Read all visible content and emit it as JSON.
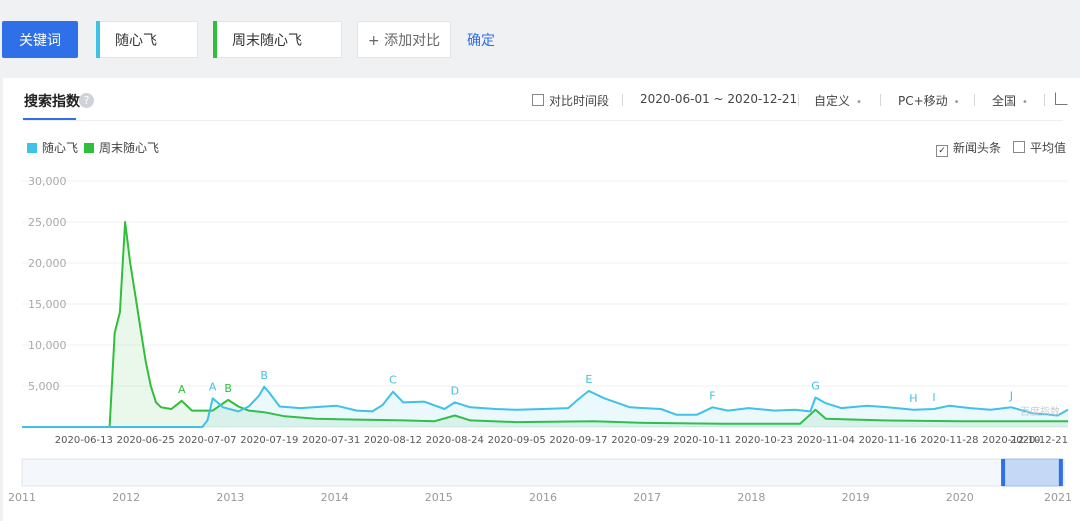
{
  "keywords": {
    "label": "关键词",
    "items": [
      {
        "name": "随心飞",
        "color": "#3fc1e8"
      },
      {
        "name": "周末随心飞",
        "color": "#2fbf3a"
      }
    ],
    "add_label": "+ 添加对比",
    "confirm_label": "确定"
  },
  "panel": {
    "title": "搜索指数",
    "help": "?",
    "compare_period": "对比时间段",
    "date_range": "2020-06-01 ~ 2020-12-21",
    "custom": "自定义",
    "device": "PC+移动",
    "region": "全国",
    "news_label": "新闻头条",
    "avg_label": "平均值",
    "watermark": "百度指数"
  },
  "chart_data": {
    "type": "line",
    "yticks": [
      "30,000",
      "25,000",
      "20,000",
      "15,000",
      "10,000",
      "5,000"
    ],
    "ylim": [
      0,
      30000
    ],
    "xticks": [
      "2020-06-13",
      "2020-06-25",
      "2020-07-07",
      "2020-07-19",
      "2020-07-31",
      "2020-08-12",
      "2020-08-24",
      "2020-09-05",
      "2020-09-17",
      "2020-09-29",
      "2020-10-11",
      "2020-10-23",
      "2020-11-04",
      "2020-11-16",
      "2020-11-28",
      "2020-12-10",
      "2020-12-21"
    ],
    "x_start": "2020-06-01",
    "x_end": "2020-12-21",
    "series": [
      {
        "name": "随心飞",
        "color": "#3fc1e8",
        "points": [
          [
            "2020-06-01",
            0
          ],
          [
            "2020-07-06",
            0
          ],
          [
            "2020-07-07",
            800
          ],
          [
            "2020-07-08",
            3500
          ],
          [
            "2020-07-10",
            2400
          ],
          [
            "2020-07-13",
            1900
          ],
          [
            "2020-07-15",
            2500
          ],
          [
            "2020-07-17",
            3800
          ],
          [
            "2020-07-18",
            4900
          ],
          [
            "2020-07-19",
            4200
          ],
          [
            "2020-07-21",
            2500
          ],
          [
            "2020-07-25",
            2300
          ],
          [
            "2020-08-01",
            2600
          ],
          [
            "2020-08-05",
            2000
          ],
          [
            "2020-08-08",
            1900
          ],
          [
            "2020-08-10",
            2700
          ],
          [
            "2020-08-12",
            4300
          ],
          [
            "2020-08-14",
            3000
          ],
          [
            "2020-08-18",
            3100
          ],
          [
            "2020-08-22",
            2200
          ],
          [
            "2020-08-24",
            3000
          ],
          [
            "2020-08-27",
            2400
          ],
          [
            "2020-09-01",
            2200
          ],
          [
            "2020-09-05",
            2100
          ],
          [
            "2020-09-10",
            2200
          ],
          [
            "2020-09-15",
            2300
          ],
          [
            "2020-09-17",
            3400
          ],
          [
            "2020-09-19",
            4400
          ],
          [
            "2020-09-22",
            3500
          ],
          [
            "2020-09-27",
            2400
          ],
          [
            "2020-10-03",
            2200
          ],
          [
            "2020-10-06",
            1500
          ],
          [
            "2020-10-10",
            1500
          ],
          [
            "2020-10-13",
            2400
          ],
          [
            "2020-10-16",
            2000
          ],
          [
            "2020-10-20",
            2300
          ],
          [
            "2020-10-25",
            2000
          ],
          [
            "2020-10-29",
            2100
          ],
          [
            "2020-11-01",
            1900
          ],
          [
            "2020-11-02",
            3600
          ],
          [
            "2020-11-04",
            2900
          ],
          [
            "2020-11-07",
            2300
          ],
          [
            "2020-11-12",
            2600
          ],
          [
            "2020-11-16",
            2400
          ],
          [
            "2020-11-21",
            2100
          ],
          [
            "2020-11-25",
            2200
          ],
          [
            "2020-11-28",
            2600
          ],
          [
            "2020-12-02",
            2300
          ],
          [
            "2020-12-06",
            2100
          ],
          [
            "2020-12-10",
            2400
          ],
          [
            "2020-12-14",
            1700
          ],
          [
            "2020-12-19",
            1400
          ],
          [
            "2020-12-21",
            2100
          ]
        ]
      },
      {
        "name": "周末随心飞",
        "color": "#2fbf3a",
        "points": [
          [
            "2020-06-01",
            0
          ],
          [
            "2020-06-18",
            0
          ],
          [
            "2020-06-19",
            11500
          ],
          [
            "2020-06-20",
            14000
          ],
          [
            "2020-06-21",
            25000
          ],
          [
            "2020-06-22",
            20000
          ],
          [
            "2020-06-23",
            16000
          ],
          [
            "2020-06-24",
            12000
          ],
          [
            "2020-06-25",
            8000
          ],
          [
            "2020-06-26",
            5000
          ],
          [
            "2020-06-27",
            3000
          ],
          [
            "2020-06-28",
            2400
          ],
          [
            "2020-06-30",
            2200
          ],
          [
            "2020-07-02",
            3200
          ],
          [
            "2020-07-04",
            2000
          ],
          [
            "2020-07-08",
            2000
          ],
          [
            "2020-07-11",
            3300
          ],
          [
            "2020-07-13",
            2500
          ],
          [
            "2020-07-15",
            2000
          ],
          [
            "2020-07-18",
            1800
          ],
          [
            "2020-07-22",
            1300
          ],
          [
            "2020-07-28",
            1000
          ],
          [
            "2020-08-05",
            900
          ],
          [
            "2020-08-14",
            800
          ],
          [
            "2020-08-20",
            700
          ],
          [
            "2020-08-24",
            1400
          ],
          [
            "2020-08-27",
            800
          ],
          [
            "2020-09-05",
            600
          ],
          [
            "2020-09-20",
            700
          ],
          [
            "2020-09-30",
            500
          ],
          [
            "2020-10-15",
            400
          ],
          [
            "2020-10-30",
            400
          ],
          [
            "2020-11-02",
            2100
          ],
          [
            "2020-11-04",
            1000
          ],
          [
            "2020-11-15",
            800
          ],
          [
            "2020-11-30",
            700
          ],
          [
            "2020-12-21",
            700
          ]
        ]
      }
    ],
    "annotations": [
      {
        "text": "A",
        "series": 1,
        "date": "2020-07-02"
      },
      {
        "text": "B",
        "series": 1,
        "date": "2020-07-11"
      },
      {
        "text": "A",
        "series": 0,
        "date": "2020-07-08"
      },
      {
        "text": "B",
        "series": 0,
        "date": "2020-07-18"
      },
      {
        "text": "C",
        "series": 0,
        "date": "2020-08-12"
      },
      {
        "text": "D",
        "series": 0,
        "date": "2020-08-24"
      },
      {
        "text": "E",
        "series": 0,
        "date": "2020-09-19"
      },
      {
        "text": "F",
        "series": 0,
        "date": "2020-10-13"
      },
      {
        "text": "G",
        "series": 0,
        "date": "2020-11-02"
      },
      {
        "text": "H",
        "series": 0,
        "date": "2020-11-21"
      },
      {
        "text": "I",
        "series": 0,
        "date": "2020-11-25"
      },
      {
        "text": "J",
        "series": 0,
        "date": "2020-12-10"
      }
    ],
    "overview": {
      "years": [
        "2011",
        "2012",
        "2013",
        "2014",
        "2015",
        "2016",
        "2017",
        "2018",
        "2019",
        "2020",
        "2021"
      ],
      "selected": [
        "2020-06-01",
        "2020-12-21"
      ]
    }
  }
}
